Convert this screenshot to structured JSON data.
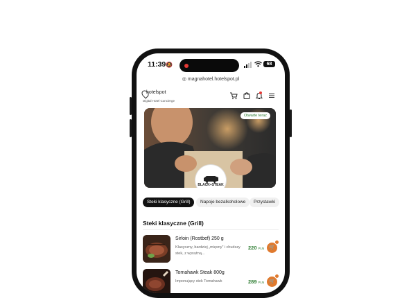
{
  "status_bar": {
    "time": "11:39",
    "battery": "68"
  },
  "browser": {
    "url": "magnahotel.hotelspot.pl"
  },
  "header": {
    "brand": "hotelspot",
    "tagline": "Digital Hotel Concierge"
  },
  "hero": {
    "badge": "Otwarte teraz",
    "restaurant_logo_text": "BLACK+STEAK"
  },
  "categories": [
    {
      "label": "Steki klasyczne (Grill)",
      "active": true
    },
    {
      "label": "Napoje bezalkoholowe",
      "active": false
    },
    {
      "label": "Przystawki",
      "active": false
    }
  ],
  "section": {
    "title": "Steki klasyczne (Grill)"
  },
  "menu_items": [
    {
      "name": "Sirloin (Rostbef) 250 g",
      "description": "Klasyczny, bardziej „mięsny” i chudszy stek, z wyraźną...",
      "price": "220",
      "currency": "PLN"
    },
    {
      "name": "Tomahawk Steak 800g",
      "description": "Imponujący stek Tomahawk",
      "price": "289",
      "currency": "PLN"
    }
  ],
  "colors": {
    "accent": "#e07a2e",
    "price": "#2e7d32",
    "open_badge": "#2e7d32",
    "active_pill": "#111111"
  }
}
